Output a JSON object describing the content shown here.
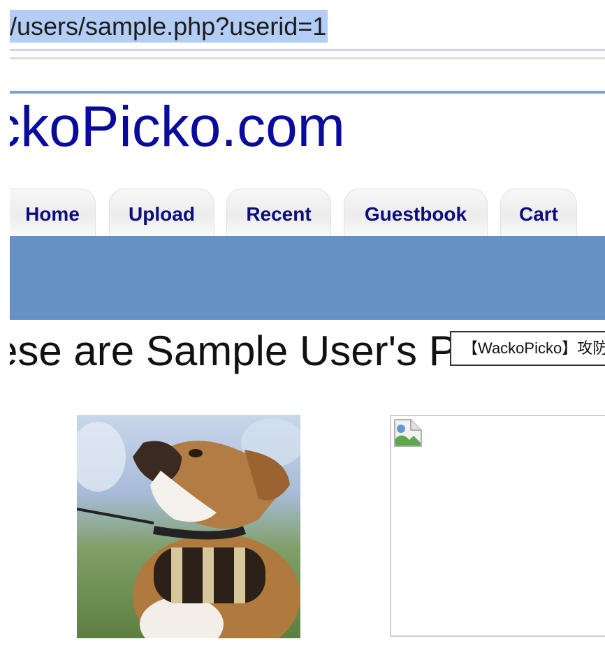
{
  "address_bar": {
    "url": "/users/sample.php?userid=1"
  },
  "site": {
    "title": "WackoPicko.com"
  },
  "nav": {
    "tabs": [
      {
        "label": "Home"
      },
      {
        "label": "Upload"
      },
      {
        "label": "Recent"
      },
      {
        "label": "Guestbook"
      },
      {
        "label": "Cart"
      }
    ]
  },
  "page": {
    "heading": "These are Sample User's Pictures"
  },
  "tooltip": {
    "text": "【WackoPicko】攻防"
  },
  "gallery": {
    "images": [
      {
        "icon": "dog-photo"
      },
      {
        "icon": "broken-image-icon"
      }
    ]
  },
  "colors": {
    "link": "#0a0a9c",
    "banner": "#6691c6",
    "selection": "#b3cdf5"
  }
}
